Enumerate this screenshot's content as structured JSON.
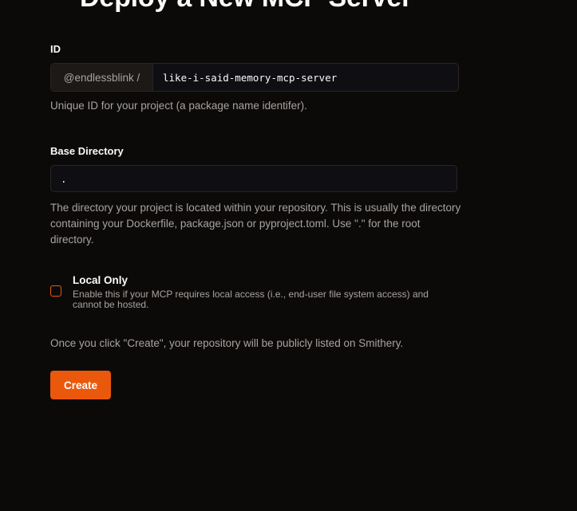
{
  "page": {
    "title": "Deploy a New MCP Server"
  },
  "id_field": {
    "label": "ID",
    "prefix": "@endlessblink /",
    "value": "like-i-said-memory-mcp-server",
    "help": "Unique ID for your project (a package name identifer)."
  },
  "base_directory": {
    "label": "Base Directory",
    "value": ".",
    "help": "The directory your project is located within your repository. This is usually the directory containing your Dockerfile, package.json or pyproject.toml. Use \".\" for the root directory."
  },
  "local_only": {
    "label": "Local Only",
    "checked": false,
    "description": "Enable this if your MCP requires local access (i.e., end-user file system access) and cannot be hosted."
  },
  "notice": "Once you click \"Create\", your repository will be publicly listed on Smithery.",
  "create_button": {
    "label": "Create"
  },
  "colors": {
    "background": "#0c0a09",
    "accent": "#ea580c",
    "muted_text": "#a8a29e"
  }
}
